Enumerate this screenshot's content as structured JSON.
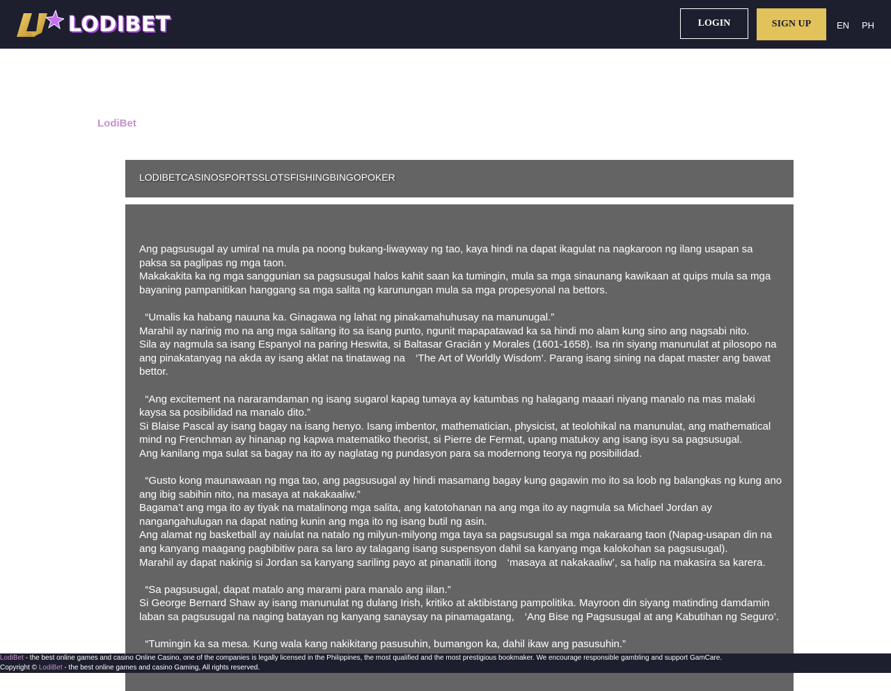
{
  "header": {
    "logo_text": "LODIBET",
    "login_label": "LOGIN",
    "signup_label": "SIGN UP",
    "lang_en": "EN",
    "lang_ph": "PH"
  },
  "colors": {
    "topbar": "#1d1f2e",
    "signup": "#e2c25a",
    "accent_pink": "#c890d0",
    "panel": "#646464"
  },
  "site_title": "LodiBet",
  "nav": [
    "LODIBET",
    "CASINO",
    "SPORTS",
    "SLOTS",
    "FISHING",
    "BINGO",
    "POKER"
  ],
  "article": {
    "p1": "Ang pagsusugal ay umiral na mula pa noong bukang-liwayway ng tao, kaya hindi na dapat ikagulat na nagkaroon ng ilang usapan sa paksa sa paglipas ng mga taon.",
    "p2": "Makakakita ka ng mga sanggunian sa pagsusugal halos kahit saan ka tumingin, mula sa mga sinaunang kawikaan at quips mula sa mga bayaning pampanitikan hanggang sa mga salita ng karunungan mula sa mga propesyonal na bettors.",
    "q1": "  “Umalis ka habang nauuna ka. Ginagawa ng lahat ng pinakamahuhusay na manunugal.”",
    "p3": "Marahil ay narinig mo na ang mga salitang ito sa isang punto, ngunit mapapatawad ka sa hindi mo alam kung sino ang nagsabi nito.",
    "p4": "Sila ay nagmula sa isang Espanyol na paring Heswita, si Baltasar Gracián y Morales (1601-1658). Isa rin siyang manunulat at pilosopo na ang pinakatanyag na akda ay isang aklat na tinatawag na　‘The Art of Worldly Wisdom’. Parang isang sining na dapat master ang bawat bettor.",
    "q2": "  “Ang excitement na nararamdaman ng isang sugarol kapag tumaya ay katumbas ng halagang maaari niyang manalo na mas malaki kaysa sa posibilidad na manalo dito.”",
    "p5": "Si Blaise Pascal ay isang bagay na isang henyo. Isang imbentor, mathematician, physicist, at teolohikal na manunulat, ang mathematical mind ng Frenchman ay hinanap ng kapwa matematiko theorist, si Pierre de Fermat, upang matukoy ang isang isyu sa pagsusugal.",
    "p6": "Ang kanilang mga sulat sa bagay na ito ay naglatag ng pundasyon para sa modernong teorya ng posibilidad.",
    "q3": "  “Gusto kong maunawaan ng mga tao, ang pagsusugal ay hindi masamang bagay kung gagawin mo ito sa loob ng balangkas ng kung ano ang ibig sabihin nito, na masaya at nakakaaliw.”",
    "p7": "Bagama’t ang mga ito ay tiyak na matalinong mga salita, ang katotohanan na ang mga ito ay nagmula sa Michael Jordan ay nangangahulugan na dapat nating kunin ang mga ito ng isang butil ng asin.",
    "p8": "Ang alamat ng basketball ay naiulat na natalo ng milyun-milyong mga taya sa pagsusugal sa mga nakaraang taon (Napag-usapan din na ang kanyang maagang pagbibitiw para sa laro ay talagang isang suspensyon dahil sa kanyang mga kalokohan sa pagsusugal).",
    "p9": "Marahil ay dapat nakinig si Jordan sa kanyang sariling payo at pinanatili itong　‘masaya at nakakaaliw’, sa halip na makasira sa karera.",
    "q4": "  “Sa pagsusugal, dapat matalo ang marami para manalo ang iilan.”",
    "p10": "Si George Bernard Shaw ay isang manunulat ng dulang Irish, kritiko at aktibistang pampolitika. Mayroon din siyang matinding damdamin laban sa pagsusugal na naging batayan ng kanyang sanaysay na pinamagatang,　‘Ang Bise ng Pagsusugal at ang Kabutihan ng Seguro’.",
    "q5": "  “Tumingin ka sa mesa. Kung wala kang nakikitang pasusuhin, bumangon ka, dahil ikaw ang pasusuhin.”"
  },
  "footer": {
    "brand1": "LodiBet",
    "text1": " - the best online games and casino Online Casino, one of the companies is legally licensed in the Philippines, the most qualified and the most prestigious bookmaker. We encourage responsible gambling and support GamCare.",
    "copyright": "Copyright © ",
    "brand2": "LodiBet",
    "text2": " - the best online games and casino Gaming, All rights reserved."
  }
}
